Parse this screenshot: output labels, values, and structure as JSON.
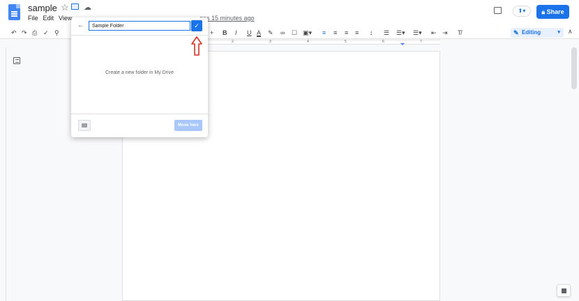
{
  "header": {
    "title": "sample",
    "menu": [
      "File",
      "Edit",
      "View"
    ],
    "last_edit": "gas 15 minutes ago",
    "share_label": "Share"
  },
  "toolbar": {
    "editing_label": "Editing"
  },
  "ruler": {
    "numbers": [
      "2",
      "3",
      "4",
      "5",
      "6",
      "7"
    ]
  },
  "dialog": {
    "folder_name_value": "Sample Folder",
    "message": "Create a new folder in My Drive",
    "move_here_label": "Move here"
  },
  "annotation": {
    "arrow_color": "#d93025"
  },
  "colors": {
    "accent": "#1a73e8",
    "disabled_button": "#a8c7fa"
  },
  "icons": [
    "docs-logo-icon",
    "star-icon",
    "move-folder-icon",
    "cloud-status-icon",
    "comment-icon",
    "present-icon",
    "lock-icon",
    "back-arrow-icon",
    "checkmark-icon",
    "new-folder-icon",
    "outline-icon",
    "pencil-icon",
    "explore-icon"
  ]
}
